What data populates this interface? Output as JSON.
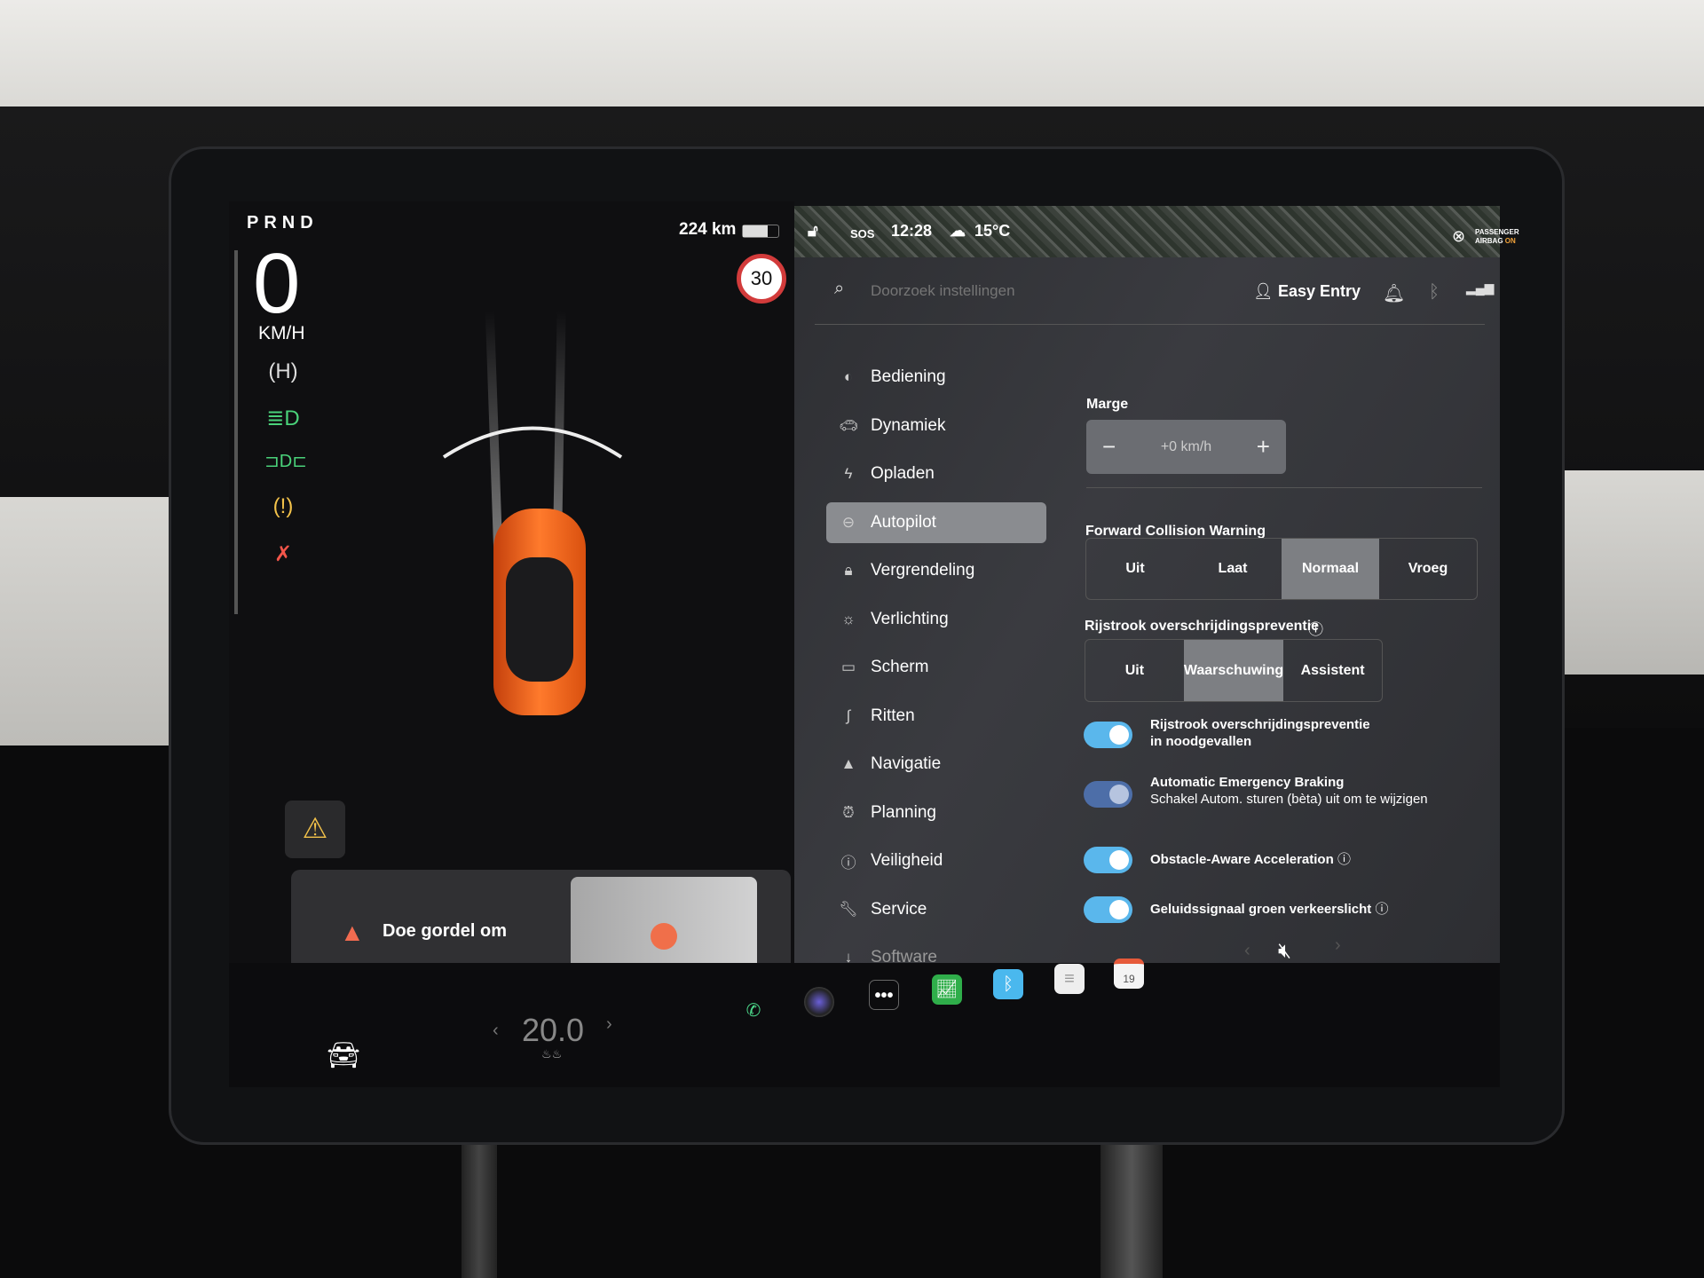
{
  "status_bar": {
    "sos": "SOS",
    "time": "12:28",
    "temperature": "15°C",
    "airbag_line1": "PASSENGER",
    "airbag_line2": "AIRBAG",
    "airbag_state": "ON"
  },
  "driving": {
    "gear": "PRND",
    "speed": "0",
    "unit": "KM/H",
    "range": "224 km",
    "battery_percent": 70,
    "speed_limit": "30",
    "indicators": [
      "auto-hold-icon",
      "low-beam-icon",
      "parking-lights-icon",
      "tire-pressure-warning-icon",
      "seatbelt-warning-icon"
    ]
  },
  "alert": {
    "message": "Doe gordel om"
  },
  "header": {
    "search_placeholder": "Doorzoek instellingen",
    "profile": "Easy Entry"
  },
  "sidebar": {
    "items": [
      {
        "label": "Bediening",
        "icon": "toggle-icon"
      },
      {
        "label": "Dynamiek",
        "icon": "car-icon"
      },
      {
        "label": "Opladen",
        "icon": "bolt-icon"
      },
      {
        "label": "Autopilot",
        "icon": "steering-wheel-icon",
        "active": true
      },
      {
        "label": "Vergrendeling",
        "icon": "lock-icon"
      },
      {
        "label": "Verlichting",
        "icon": "sun-icon"
      },
      {
        "label": "Scherm",
        "icon": "display-icon"
      },
      {
        "label": "Ritten",
        "icon": "trips-icon"
      },
      {
        "label": "Navigatie",
        "icon": "navigation-icon"
      },
      {
        "label": "Planning",
        "icon": "alarm-clock-icon"
      },
      {
        "label": "Veiligheid",
        "icon": "info-icon"
      },
      {
        "label": "Service",
        "icon": "wrench-icon"
      },
      {
        "label": "Software",
        "icon": "download-icon"
      }
    ]
  },
  "settings": {
    "marge": {
      "label": "Marge",
      "value": "+0 km/h",
      "minus": "−",
      "plus": "+"
    },
    "fcw": {
      "label": "Forward Collision Warning",
      "options": [
        "Uit",
        "Laat",
        "Normaal",
        "Vroeg"
      ],
      "selected": "Normaal"
    },
    "ldp": {
      "label": "Rijstrook overschrijdingspreventie",
      "options": [
        "Uit",
        "Waarschuwing",
        "Assistent"
      ],
      "selected": "Waarschuwing"
    },
    "toggles": [
      {
        "label": "Rijstrook overschrijdingspreventie in noodgevallen",
        "on": true
      },
      {
        "label": "Automatic Emergency Braking",
        "sub": "Schakel Autom. sturen (bèta) uit om te wijzigen",
        "on": true,
        "disabled": true
      },
      {
        "label": "Obstacle-Aware Acceleration",
        "on": true,
        "info": true
      },
      {
        "label": "Geluidssignaal groen verkeerslicht",
        "on": true,
        "info": true
      }
    ]
  },
  "bottom": {
    "temperature": "20.0",
    "calendar_day": "19",
    "colors": {
      "toggle": "#5ab7ec",
      "phone": "#4cd98a",
      "warning": "#f26b50"
    }
  }
}
